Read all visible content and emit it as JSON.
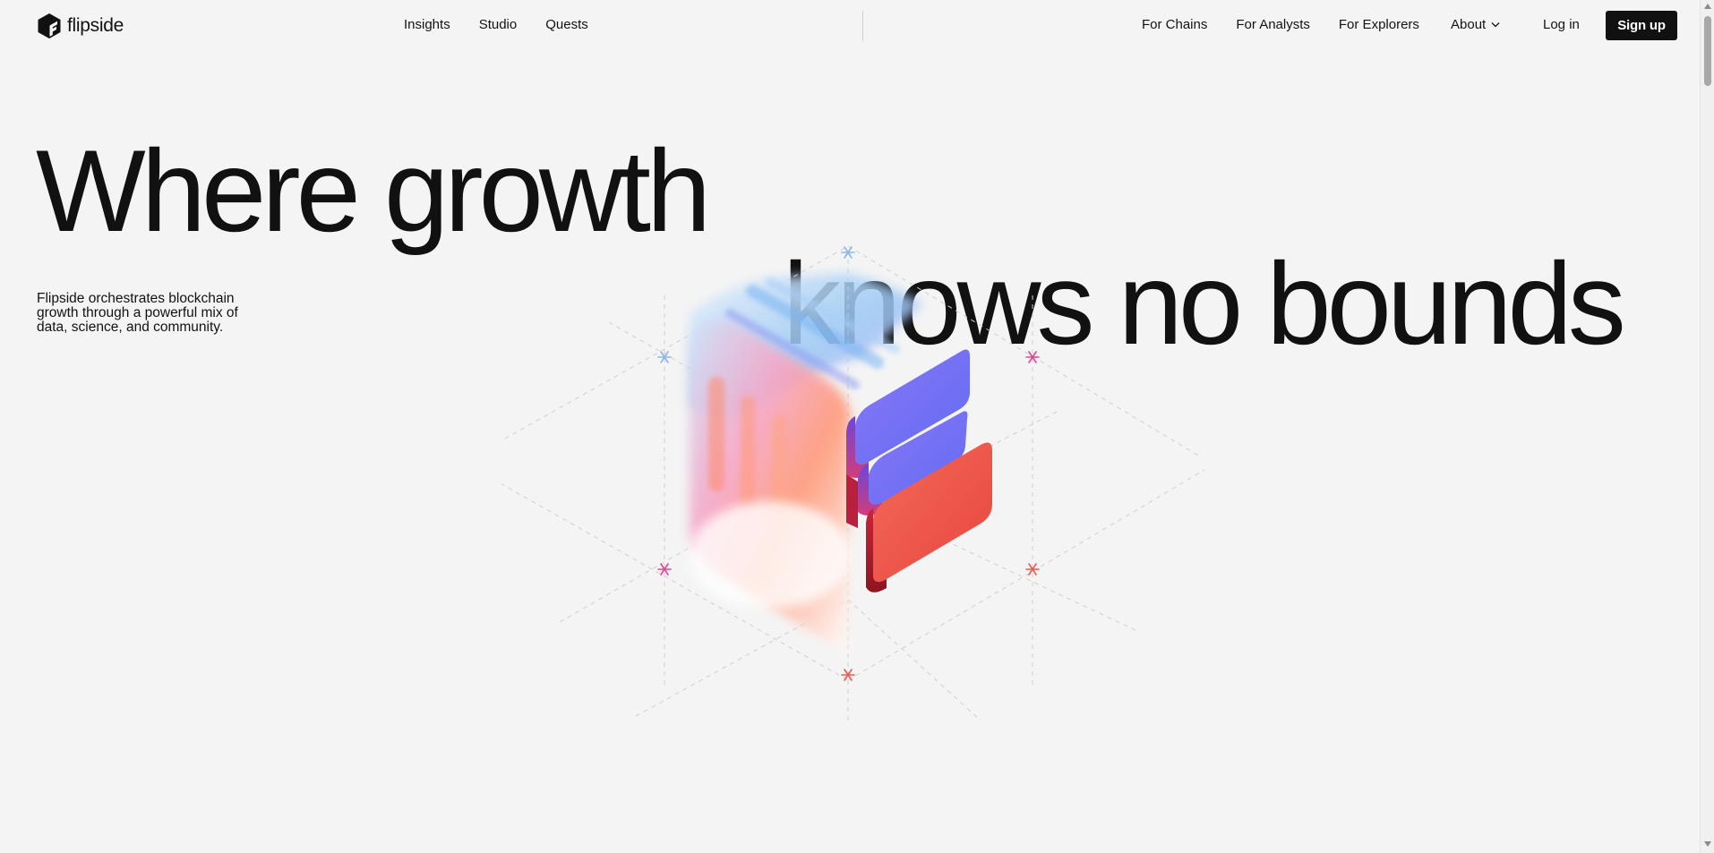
{
  "brand": {
    "name": "flipside"
  },
  "nav": {
    "primary": [
      {
        "label": "Insights"
      },
      {
        "label": "Studio"
      },
      {
        "label": "Quests"
      }
    ],
    "audience": [
      {
        "label": "For Chains"
      },
      {
        "label": "For Analysts"
      },
      {
        "label": "For Explorers"
      }
    ],
    "about_label": "About",
    "login_label": "Log in",
    "signup_label": "Sign up"
  },
  "hero": {
    "headline_line1": "Where growth",
    "headline_line2": "knows no bounds",
    "description": "Flipside orchestrates blockchain growth through a powerful mix of data, science, and community."
  },
  "icons": {
    "logo": "flipside-logo-icon",
    "about_dropdown": "chevron-down-icon",
    "illustration": "3d-cube-logo-illustration"
  },
  "colors": {
    "background": "#f4f4f4",
    "text": "#121212",
    "button_bg": "#111111",
    "button_text": "#ffffff",
    "accent_blue": "#6b8cf5",
    "accent_red": "#ec5a4d",
    "accent_pink": "#e0478f",
    "accent_lightblue": "#8ab8e8"
  }
}
